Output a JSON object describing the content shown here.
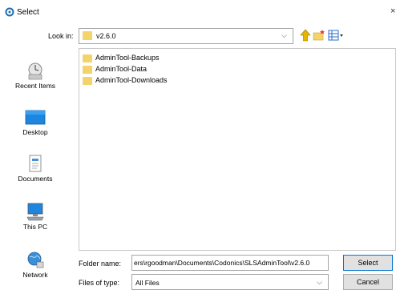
{
  "window": {
    "title": "Select",
    "close_glyph": "×"
  },
  "look_in": {
    "label": "Look in:",
    "value": "v2.6.0",
    "chevron": "⌵"
  },
  "toolbar": {
    "up_icon": "up-folder-icon",
    "new_folder_icon": "new-folder-icon",
    "view_menu_icon": "view-menu-icon"
  },
  "places": [
    {
      "label": "Recent Items",
      "icon": "recent-items-icon"
    },
    {
      "label": "Desktop",
      "icon": "desktop-icon"
    },
    {
      "label": "Documents",
      "icon": "documents-icon"
    },
    {
      "label": "This PC",
      "icon": "this-pc-icon"
    },
    {
      "label": "Network",
      "icon": "network-icon"
    }
  ],
  "files": [
    {
      "label": "AdminTool-Backups"
    },
    {
      "label": "AdminTool-Data"
    },
    {
      "label": "AdminTool-Downloads"
    }
  ],
  "folder_name": {
    "label": "Folder name:",
    "value": "ers\\rgoodman\\Documents\\Codonics\\SLSAdminTool\\v2.6.0"
  },
  "files_of_type": {
    "label": "Files of type:",
    "value": "All Files",
    "chevron": "⌵"
  },
  "buttons": {
    "select": "Select",
    "cancel": "Cancel"
  },
  "colors": {
    "folder": "#f4d36a",
    "select_border": "#0078d7",
    "button_bg": "#e1e1e1"
  }
}
